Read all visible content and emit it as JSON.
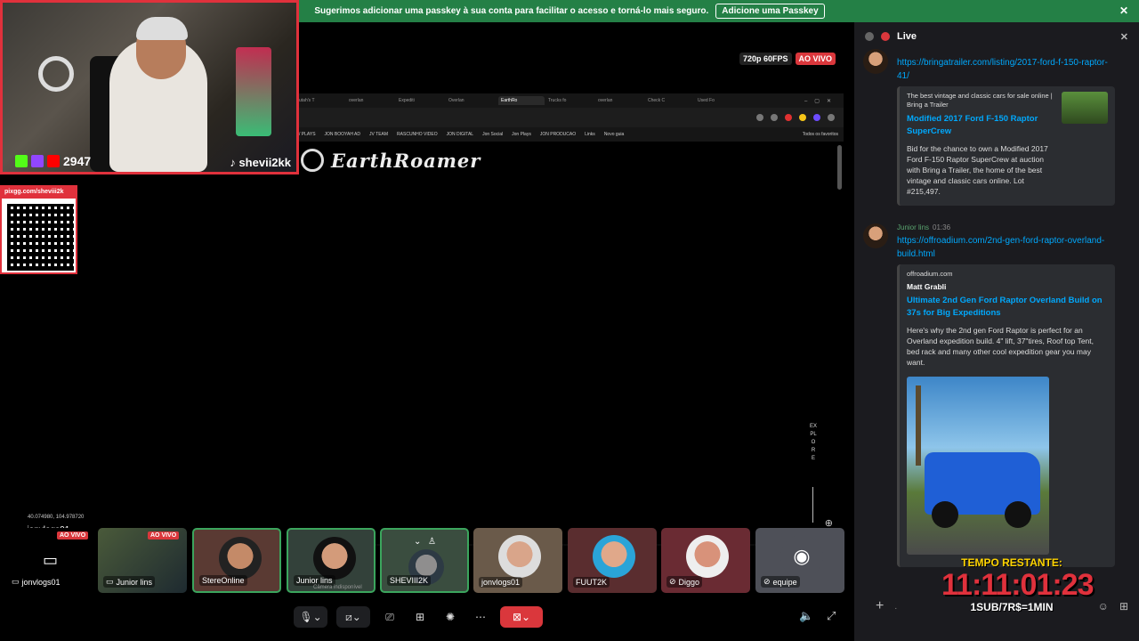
{
  "banner": {
    "message": "Sugerimos adicionar uma passkey à sua conta para facilitar o acesso e torná-lo mais seguro.",
    "cta": "Adicione uma Passkey",
    "close_icon": "close-icon"
  },
  "stream": {
    "quality": "720p 60FPS",
    "live_label": "AO VIVO",
    "owner": "jonvlogs01",
    "coords": "40.074980, 104.978720"
  },
  "browser": {
    "tabs": [
      "utah's T",
      "overlan",
      "Expediti",
      "Overlan",
      "EarthRo",
      "Trucks fo",
      "overlan",
      "Check C",
      "Used Fo"
    ],
    "bookmarks": [
      "/ PLAYS",
      "JON BOOYAH AD",
      "JV TEAM",
      "RASCUNHO VIDEO",
      "JON DIGITAL",
      "Jon Social",
      "Jon Plays",
      "JON PRODUCAO",
      "Links",
      "Novo guia",
      "Todos os favoritos"
    ],
    "site_logo": "EarthRoamer",
    "explore": "EXPLORE"
  },
  "webcam": {
    "viewer_count": "2947",
    "handle": "shevii2kk",
    "colors": {
      "kick": "#53fc18",
      "twitch": "#9146ff",
      "youtube": "#ff0000"
    }
  },
  "pix": {
    "label": "pixgg.com/sheviii2k"
  },
  "tiles": [
    {
      "name": "jonvlogs01",
      "live": "AO VIVO"
    },
    {
      "name": "Junior lins",
      "live": "AO VIVO"
    },
    {
      "name": "StereOnline"
    },
    {
      "name": "Junior lins",
      "sub": "Câmera indisponível"
    },
    {
      "name": "SHEVIII2K"
    },
    {
      "name": "jonvlogs01"
    },
    {
      "name": "FUUT2K"
    },
    {
      "name": "Diggo"
    },
    {
      "name": "equipe"
    }
  ],
  "panel": {
    "title": "Live",
    "messages": [
      {
        "link": "https://bringatrailer.com/listing/2017-ford-f-150-raptor-41/",
        "embed": {
          "provider": "The best vintage and classic cars for sale online | Bring a Trailer",
          "title": "Modified 2017 Ford F-150 Raptor SuperCrew",
          "description": "Bid for the chance to own a Modified 2017 Ford F-150 Raptor SuperCrew at auction with Bring a Trailer, the home of the best vintage and classic cars online. Lot #215,497."
        }
      },
      {
        "author": "Junior lins",
        "time": "01:36",
        "link": "https://offroadium.com/2nd-gen-ford-raptor-overland-build.html",
        "embed": {
          "provider": "offroadium.com",
          "author": "Matt Grabli",
          "title": "Ultimate 2nd Gen Ford Raptor Overland Build on 37s for Big Expeditions",
          "description": "Here's why the 2nd gen Ford Raptor is perfect for an Overland expedition build. 4\" lift, 37\"tires, Roof top Tent, bed rack and many other cool expedition gear you may want."
        }
      }
    ]
  },
  "timer": {
    "label": "TEMPO RESTANTE:",
    "value": "11:11:01:23",
    "rule": "1SUB/7R$=1MIN"
  }
}
